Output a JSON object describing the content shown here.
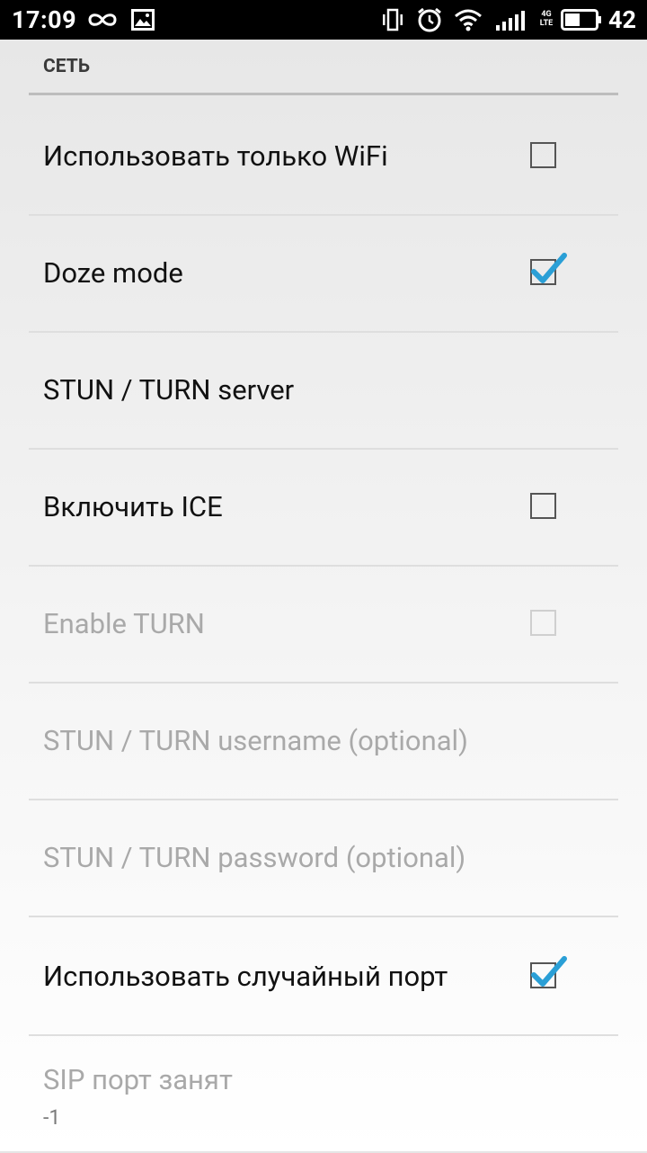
{
  "status_bar": {
    "time": "17:09",
    "battery_level": "42",
    "network_label_top": "4G",
    "network_label_bottom": "LTE",
    "icons": [
      "infinity-icon",
      "image-icon",
      "vibrate-icon",
      "alarm-icon",
      "wifi-icon",
      "signal-icon",
      "battery-icon"
    ]
  },
  "section": {
    "title": "СЕТЬ"
  },
  "settings": [
    {
      "label": "Использовать только WiFi",
      "checkbox": "unchecked",
      "enabled": true
    },
    {
      "label": "Doze mode",
      "checkbox": "checked",
      "enabled": true
    },
    {
      "label": "STUN / TURN server",
      "checkbox": "none",
      "enabled": true
    },
    {
      "label": "Включить ICE",
      "checkbox": "unchecked",
      "enabled": true
    },
    {
      "label": "Enable TURN",
      "checkbox": "unchecked",
      "enabled": false
    },
    {
      "label": "STUN / TURN username (optional)",
      "checkbox": "none",
      "enabled": false
    },
    {
      "label": "STUN / TURN password (optional)",
      "checkbox": "none",
      "enabled": false
    },
    {
      "label": "Использовать случайный порт",
      "checkbox": "checked",
      "enabled": true
    },
    {
      "label": "SIP порт занят",
      "summary": "-1",
      "checkbox": "none",
      "enabled": false
    }
  ],
  "colors": {
    "check_accent": "#2a9fd6",
    "disabled_text": "#a9a9a9",
    "divider": "#dedede"
  }
}
